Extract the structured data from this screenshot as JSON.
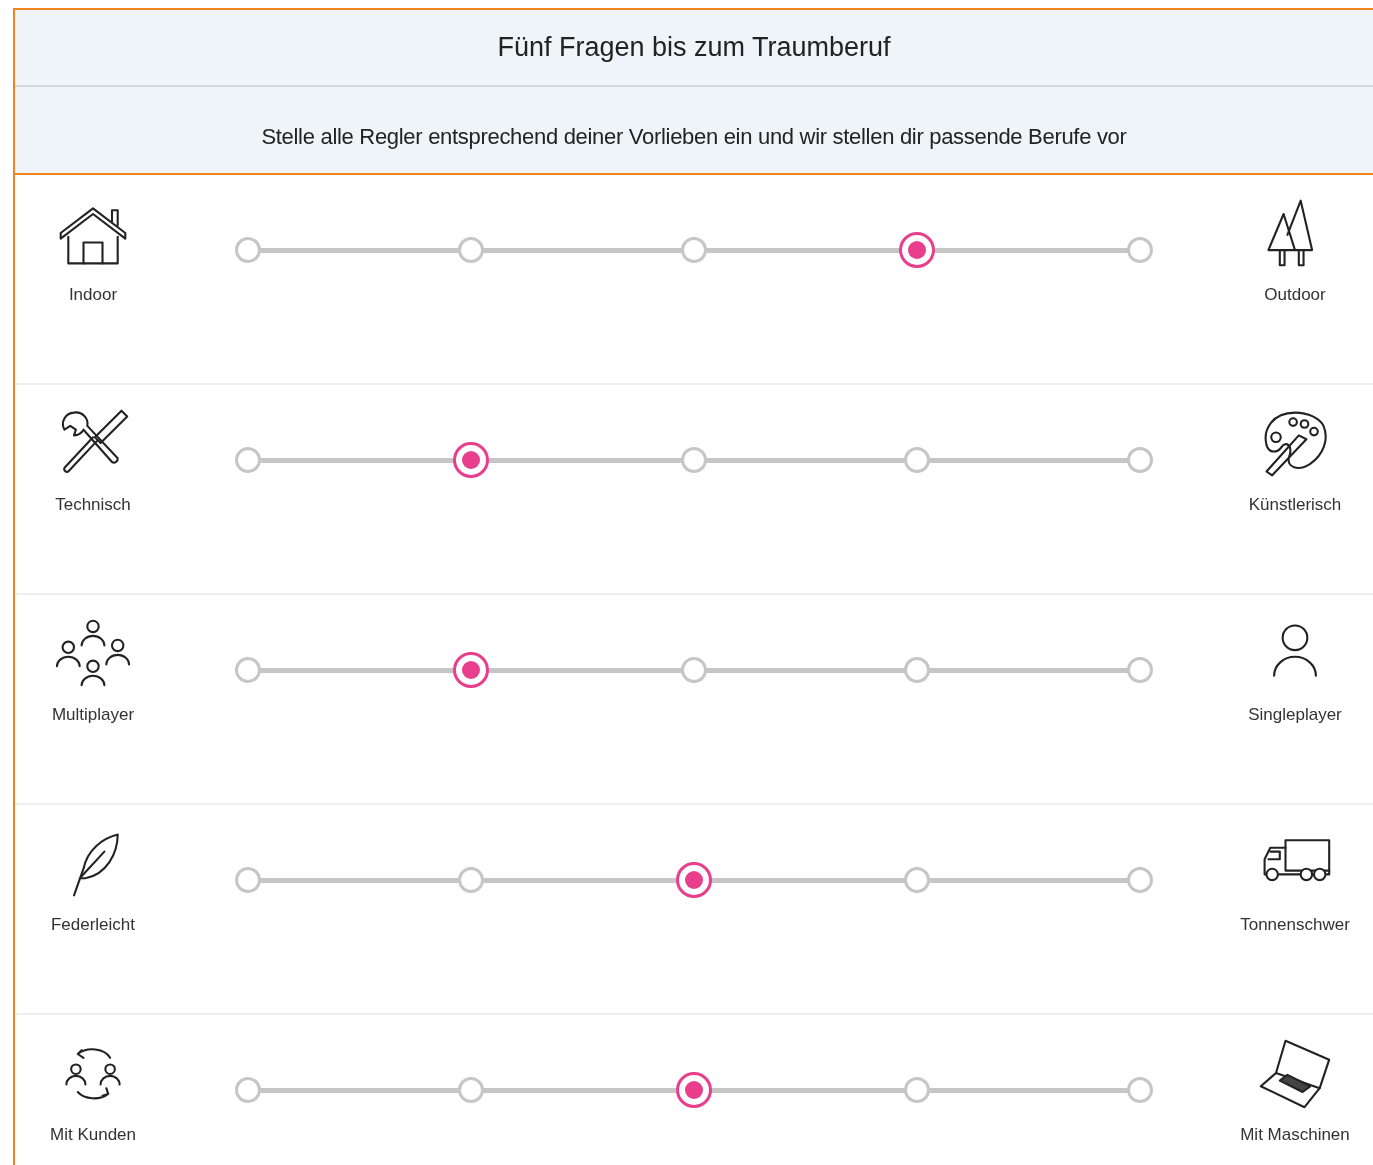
{
  "title": "Fünf Fragen bis zum Traumberuf",
  "subtitle": "Stelle alle Regler entsprechend deiner Vorlieben ein und wir stellen dir passende Berufe vor",
  "sliders": [
    {
      "left": {
        "label": "Indoor"
      },
      "right": {
        "label": "Outdoor"
      },
      "level": 0.75
    },
    {
      "left": {
        "label": "Technisch"
      },
      "right": {
        "label": "Künstlerisch"
      },
      "level": 0.25
    },
    {
      "left": {
        "label": "Multiplayer"
      },
      "right": {
        "label": "Singleplayer"
      },
      "level": 0.25
    },
    {
      "left": {
        "label": "Federleicht"
      },
      "right": {
        "label": "Tonnenschwer"
      },
      "level": 0.5
    },
    {
      "left": {
        "label": "Mit Kunden"
      },
      "right": {
        "label": "Mit Maschinen"
      },
      "level": 0.5
    }
  ]
}
